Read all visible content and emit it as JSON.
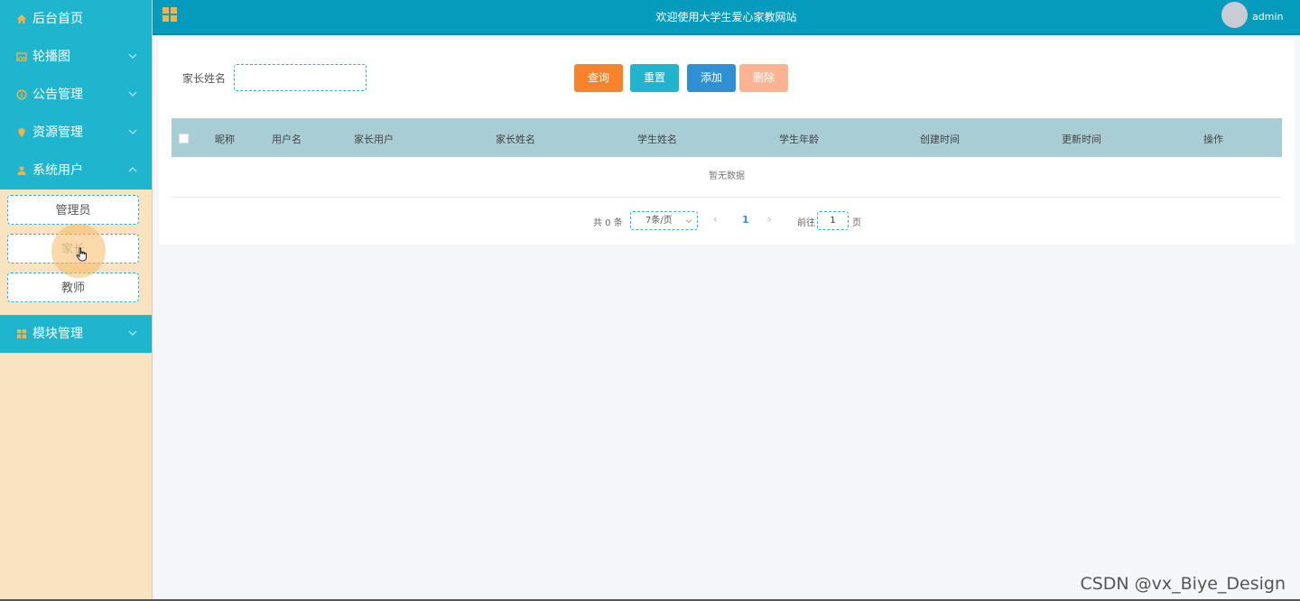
{
  "sidebar": {
    "items": [
      {
        "label": "后台首页",
        "icon": "home-icon"
      },
      {
        "label": "轮播图",
        "icon": "image-icon"
      },
      {
        "label": "公告管理",
        "icon": "info-icon"
      },
      {
        "label": "资源管理",
        "icon": "location-icon"
      },
      {
        "label": "系统用户",
        "icon": "user-icon"
      },
      {
        "label": "模块管理",
        "icon": "grid-icon"
      }
    ],
    "submenu": [
      "管理员",
      "家长",
      "教师"
    ]
  },
  "header": {
    "title": "欢迎使用大学生爱心家教网站",
    "username": "admin"
  },
  "search": {
    "label": "家长姓名",
    "value": "",
    "placeholder": ""
  },
  "buttons": {
    "query": "查询",
    "reset": "重置",
    "add": "添加",
    "delete": "删除"
  },
  "table": {
    "columns": [
      "昵称",
      "用户名",
      "家长用户",
      "家长姓名",
      "学生姓名",
      "学生年龄",
      "创建时间",
      "更新时间",
      "操作"
    ],
    "empty_text": "暂无数据"
  },
  "pagination": {
    "total": "共 0 条",
    "page_size": "7条/页",
    "current_page": "1",
    "goto_label": "前往",
    "goto_value": "1",
    "page_suffix": "页"
  },
  "watermark": "CSDN @vx_Biye_Design",
  "colors": {
    "header": "#049bbd",
    "menu": "#1fb5cf",
    "sidebar_bg": "#fae3c1",
    "query": "#f7842d",
    "reset": "#21b4cc",
    "add": "#2f91d3",
    "delete": "#fbb493"
  }
}
